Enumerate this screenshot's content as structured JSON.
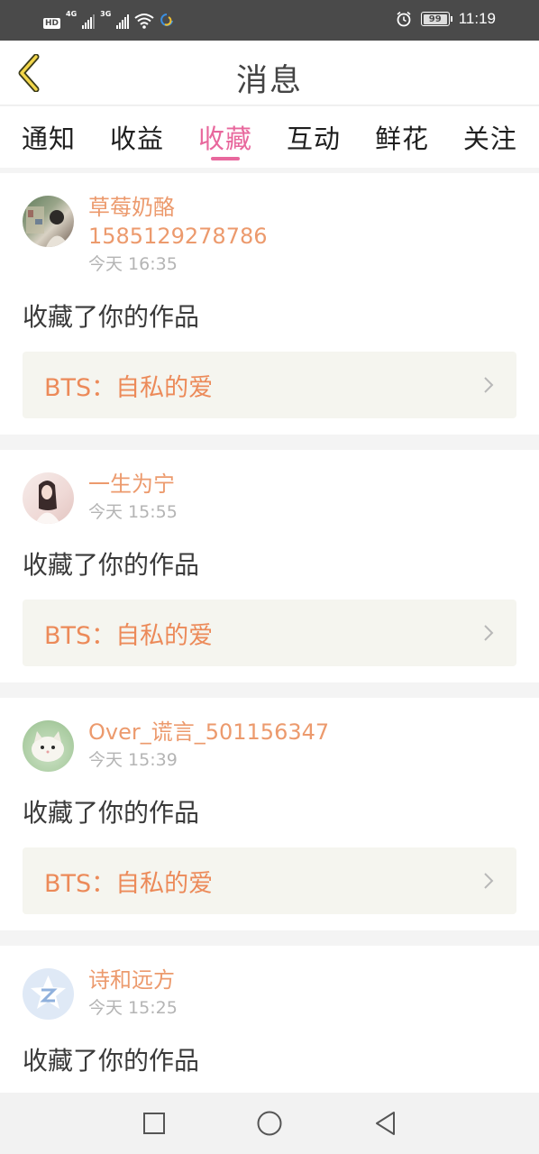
{
  "status_bar": {
    "hd": "HD",
    "net1": "4G",
    "net2": "3G",
    "battery": "99",
    "time": "11:19"
  },
  "header": {
    "title": "消息",
    "back_icon": "chevron-left-icon",
    "accent_color": "#e8689d"
  },
  "tabs": [
    {
      "label": "通知",
      "active": false
    },
    {
      "label": "收益",
      "active": false
    },
    {
      "label": "收藏",
      "active": true
    },
    {
      "label": "互动",
      "active": false
    },
    {
      "label": "鲜花",
      "active": false
    },
    {
      "label": "关注",
      "active": false
    }
  ],
  "items": [
    {
      "username": "草莓奶酪",
      "username_line2": "1585129278786",
      "time": "今天 16:35",
      "action": "收藏了你的作品",
      "work_title": "BTS：自私的爱"
    },
    {
      "username": "一生为宁",
      "time": "今天 15:55",
      "action": "收藏了你的作品",
      "work_title": "BTS：自私的爱"
    },
    {
      "username": "Over_谎言_501156347",
      "time": "今天 15:39",
      "action": "收藏了你的作品",
      "work_title": "BTS：自私的爱"
    },
    {
      "username": "诗和远方",
      "time": "今天 15:25",
      "action": "收藏了你的作品",
      "work_title": ""
    }
  ],
  "nav_bar": {
    "icons": [
      "recents-square-icon",
      "home-circle-icon",
      "back-triangle-icon"
    ]
  }
}
